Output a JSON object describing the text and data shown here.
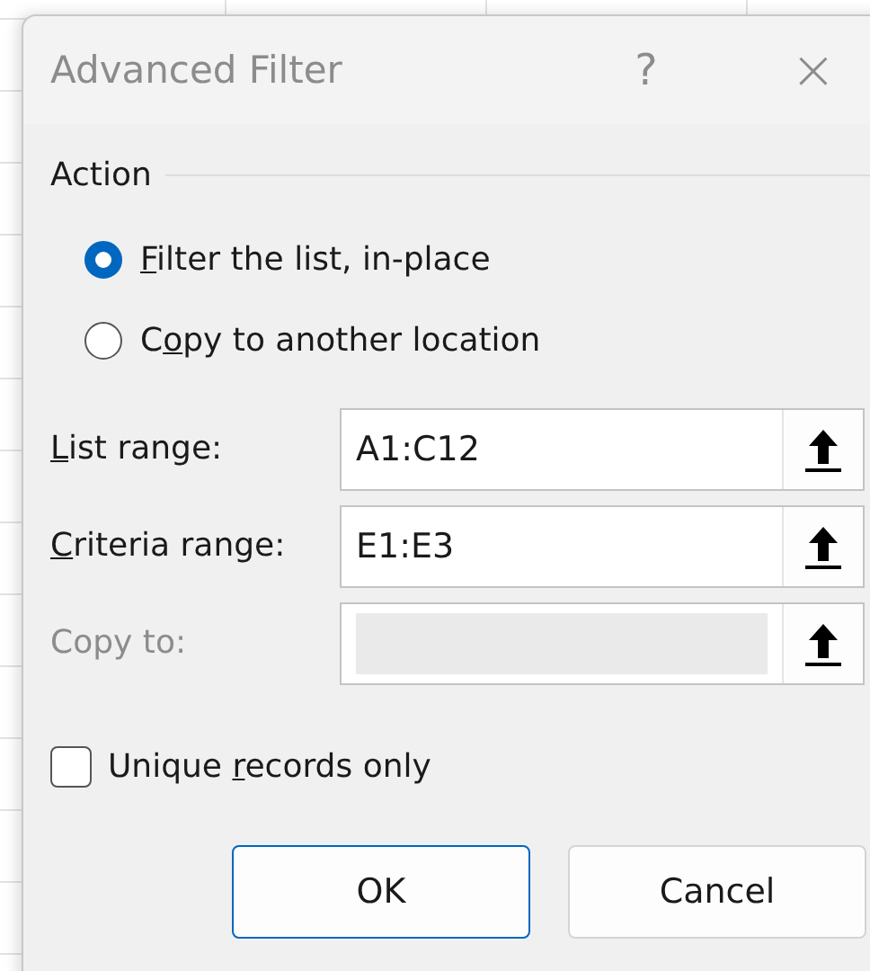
{
  "window": {
    "title": "Advanced Filter",
    "help": "?",
    "close": "×"
  },
  "action": {
    "legend": "Action",
    "options": [
      {
        "key": "F",
        "post": "ilter the list, in-place",
        "selected": true
      },
      {
        "pre": "C",
        "key": "o",
        "post": "py to another location",
        "selected": false
      }
    ]
  },
  "fields": [
    {
      "key": "L",
      "post": "ist range:",
      "value": "A1:C12",
      "disabled": false
    },
    {
      "key": "C",
      "post": "riteria range:",
      "value": "E1:E3",
      "disabled": false
    },
    {
      "pre": "Copy to:",
      "disabled": true
    }
  ],
  "unique": {
    "pre": "Unique ",
    "key": "r",
    "post": "ecords only",
    "checked": false
  },
  "buttons": [
    {
      "label": "OK",
      "default": true
    },
    {
      "label": "Cancel",
      "default": false
    }
  ]
}
